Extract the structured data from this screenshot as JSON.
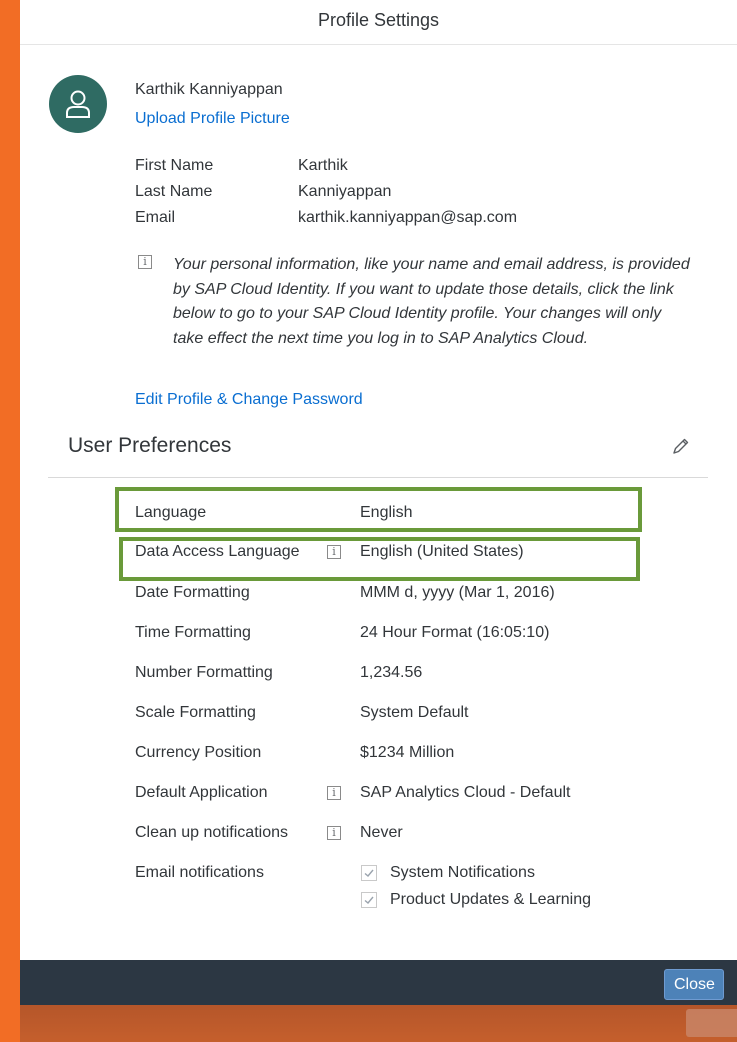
{
  "dialog": {
    "title": "Profile Settings"
  },
  "profile": {
    "full_name": "Karthik Kanniyappan",
    "upload_label": "Upload Profile Picture",
    "fields": [
      {
        "label": "First Name",
        "value": "Karthik"
      },
      {
        "label": "Last Name",
        "value": "Kanniyappan"
      },
      {
        "label": "Email",
        "value": "karthik.kanniyappan@sap.com"
      }
    ],
    "info_text": "Your personal information, like your name and email address, is provided by SAP Cloud Identity. If you want to update those details, click the link below to go to your SAP Cloud Identity profile. Your changes will only take effect the next time you log in to SAP Analytics Cloud.",
    "edit_link": "Edit Profile & Change Password"
  },
  "preferences": {
    "title": "User Preferences",
    "rows": [
      {
        "label": "Language",
        "value": "English"
      },
      {
        "label": "Data Access Language",
        "value": "English (United States)"
      },
      {
        "label": "Date Formatting",
        "value": "MMM d, yyyy (Mar 1, 2016)"
      },
      {
        "label": "Time Formatting",
        "value": "24 Hour Format (16:05:10)"
      },
      {
        "label": "Number Formatting",
        "value": "1,234.56"
      },
      {
        "label": "Scale Formatting",
        "value": "System Default"
      },
      {
        "label": "Currency Position",
        "value": "$1234 Million"
      },
      {
        "label": "Default Application",
        "value": "SAP Analytics Cloud - Default"
      },
      {
        "label": "Clean up notifications",
        "value": "Never"
      },
      {
        "label": "Email notifications",
        "value": ""
      }
    ],
    "email_options": [
      {
        "label": "System Notifications",
        "checked": true
      },
      {
        "label": "Product Updates & Learning",
        "checked": true
      }
    ]
  },
  "footer": {
    "close_label": "Close"
  },
  "icons": {
    "avatar": "person-icon",
    "info": "info-icon",
    "edit": "pencil-icon",
    "check": "checkmark-icon"
  },
  "colors": {
    "background": "#f26d25",
    "avatar": "#2f6b63",
    "link": "#0a6ed1",
    "highlight": "#6a9a3a",
    "footer": "#2c3743",
    "button": "#4d82b8"
  }
}
